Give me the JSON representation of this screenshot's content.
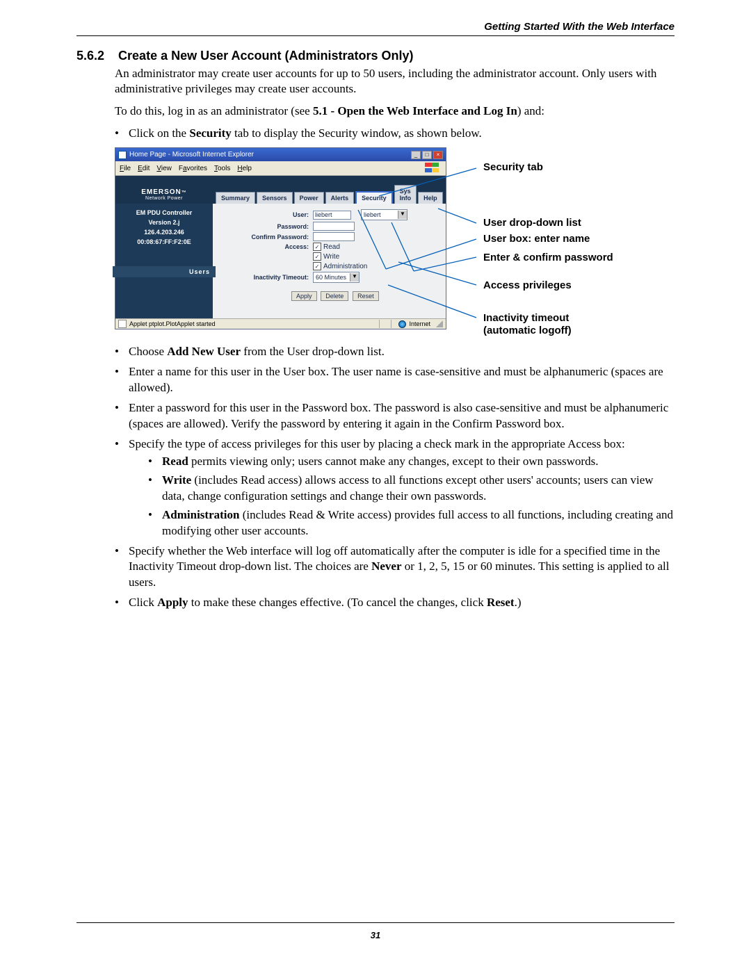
{
  "header": {
    "right": "Getting Started With the Web Interface"
  },
  "section": {
    "number": "5.6.2",
    "title": "Create a New User Account (Administrators Only)",
    "intro1": "An administrator may create user accounts for up to 50 users, including the administrator account. Only users with administrative privileges may create user accounts.",
    "intro2_prefix": "To do this, log in as an administrator (see ",
    "intro2_ref": "5.1 - Open the Web Interface and Log In",
    "intro2_suffix": ") and:",
    "bullet_click_prefix": "Click on the ",
    "bullet_click_bold": "Security",
    "bullet_click_suffix": " tab to display the Security window, as shown below.",
    "bul2_prefix": "Choose ",
    "bul2_bold": "Add New User",
    "bul2_suffix": " from the User drop-down list.",
    "bul3": "Enter a name for this user in the User box. The user name is case-sensitive and must be alphanumeric (spaces are allowed).",
    "bul4": "Enter a password for this user in the Password box. The password is also case-sensitive and must be alphanumeric (spaces are allowed). Verify the password by entering it again in the Confirm Password box.",
    "bul5": "Specify the type of access privileges for this user by placing a check mark in the appropriate Access box:",
    "sub_read_b": "Read",
    "sub_read_t": " permits viewing only; users cannot make any changes, except to their own passwords.",
    "sub_write_b": "Write",
    "sub_write_t": " (includes Read access) allows access to all functions except other users' accounts; users can view data, change configuration settings and change their own passwords.",
    "sub_admin_b": "Administration",
    "sub_admin_t": " (includes Read & Write access) provides full access to all functions, including creating and modifying other user accounts.",
    "bul6_prefix": "Specify whether the Web interface will log off automatically after the computer is idle for a specified time in the Inactivity Timeout drop-down list. The choices are ",
    "bul6_bold": "Never",
    "bul6_suffix": " or 1, 2, 5, 15 or 60 minutes. This setting is applied to all users.",
    "bul7_p1": "Click ",
    "bul7_b1": "Apply",
    "bul7_p2": " to make these changes effective. (To cancel the changes, click ",
    "bul7_b2": "Reset",
    "bul7_p3": ".)"
  },
  "callouts": {
    "sec_tab": "Security tab",
    "dropdown": "User drop-down list",
    "userbox": "User box: enter name",
    "pwd": "Enter & confirm password",
    "access": "Access privileges",
    "timeout1": "Inactivity timeout",
    "timeout2": "(automatic logoff)"
  },
  "window": {
    "title": "Home Page - Microsoft Internet Explorer",
    "menus": [
      "File",
      "Edit",
      "View",
      "Favorites",
      "Tools",
      "Help"
    ],
    "brand": "EMERSON",
    "brand_sub": "Network Power",
    "tabs": [
      "Summary",
      "Sensors",
      "Power",
      "Alerts",
      "Security",
      "Sys Info",
      "Help"
    ],
    "side": {
      "l1": "EM PDU Controller",
      "l2": "Version 2.j",
      "l3": "126.4.203.246",
      "l4": "00:08:67:FF:F2:0E",
      "users": "Users"
    },
    "form": {
      "user_label": "User:",
      "user_value": "liebert",
      "user_dd_value": "liebert",
      "pwd_label": "Password:",
      "confirm_label": "Confirm Password:",
      "access_label": "Access:",
      "access_read": "Read",
      "access_write": "Write",
      "access_admin": "Administration",
      "timeout_label": "Inactivity Timeout:",
      "timeout_value": "60 Minutes",
      "apply": "Apply",
      "delete": "Delete",
      "reset": "Reset"
    },
    "status": {
      "text": "Applet ptplot.PlotApplet started",
      "zone": "Internet"
    }
  },
  "pagenum": "31"
}
